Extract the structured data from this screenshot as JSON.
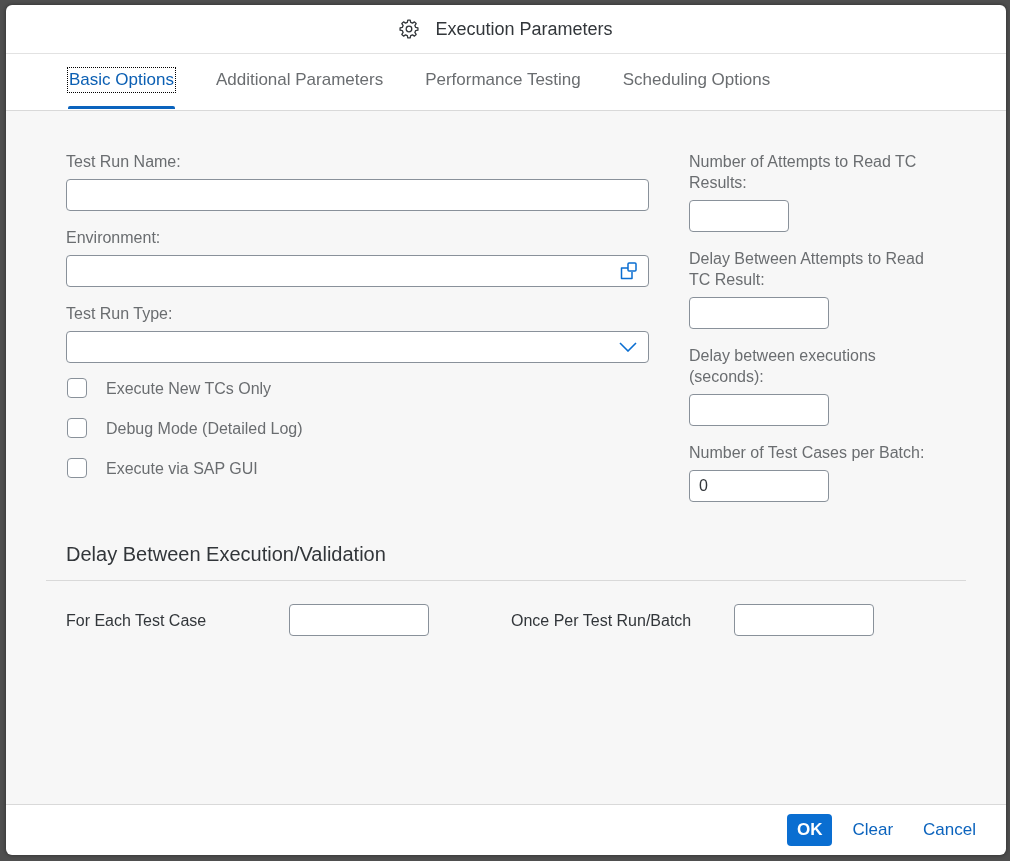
{
  "dialog": {
    "title": "Execution Parameters"
  },
  "tabs": [
    {
      "label": "Basic Options",
      "selected": true,
      "focused": true
    },
    {
      "label": "Additional Parameters",
      "selected": false,
      "focused": false
    },
    {
      "label": "Performance Testing",
      "selected": false,
      "focused": false
    },
    {
      "label": "Scheduling Options",
      "selected": false,
      "focused": false
    }
  ],
  "form": {
    "left_fields": [
      {
        "label": "Test Run Name:",
        "kind": "text"
      },
      {
        "label": "Environment:",
        "kind": "value-help"
      },
      {
        "label": "Test Run Type:",
        "kind": "select"
      }
    ],
    "checkboxes": [
      {
        "label": "Execute New TCs Only",
        "checked": false
      },
      {
        "label": "Debug Mode (Detailed Log)",
        "checked": false
      },
      {
        "label": "Execute via SAP GUI",
        "checked": false
      }
    ],
    "right_fields": [
      {
        "label": "Number of Attempts to Read TC Results:"
      },
      {
        "label": "Delay Between Attempts to Read TC Result:"
      },
      {
        "label": "Delay between executions (seconds):"
      },
      {
        "label": "Number of Test Cases per Batch:",
        "value": "0"
      }
    ]
  },
  "section": {
    "title": "Delay Between Execution/Validation",
    "fields": [
      {
        "label": "For Each Test Case"
      },
      {
        "label": "Once Per Test Run/Batch"
      }
    ]
  },
  "footer": {
    "buttons": [
      {
        "label": "OK",
        "kind": "emphasized"
      },
      {
        "label": "Clear",
        "kind": "transparent"
      },
      {
        "label": "Cancel",
        "kind": "transparent"
      }
    ]
  }
}
